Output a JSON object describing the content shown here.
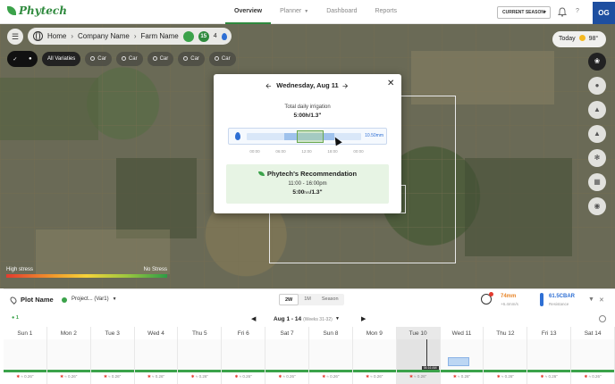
{
  "app": {
    "logo": "Phytech",
    "avatar": "OG"
  },
  "nav": {
    "items": [
      {
        "label": "Overview",
        "active": true,
        "dropdown": false
      },
      {
        "label": "Planner",
        "active": false,
        "dropdown": true
      },
      {
        "label": "Dashboard",
        "active": false,
        "dropdown": false
      },
      {
        "label": "Reports",
        "active": false,
        "dropdown": false
      }
    ],
    "season": "CURRENT SEASON",
    "help": "?"
  },
  "breadcrumb": {
    "home": "Home",
    "company": "Company Name",
    "farm": "Farm Name",
    "status_icons": [
      {
        "text": "",
        "color": "#3ba24a"
      },
      {
        "text": "15",
        "color": "#2f8a3e"
      },
      {
        "text": "4",
        "color": "#ffffff"
      }
    ]
  },
  "weather": {
    "label": "Today",
    "temp": "98°"
  },
  "varieties": {
    "all": "All Variaties",
    "items": [
      "Car",
      "Car",
      "Car",
      "Car",
      "Car"
    ]
  },
  "stress_legend": {
    "low_label": "High stress",
    "high_label": "No Stress"
  },
  "irrigation_modal": {
    "date": "Wednesday, Aug 11",
    "total_label": "Total daily irrigation",
    "total_value": "5:00h/1.3\"",
    "slider_value": "10.50mm",
    "ticks": [
      "00:00",
      "06:00",
      "12:00",
      "18:00",
      "00:00"
    ],
    "recommendation": {
      "title": "Phytech's Recommendation",
      "time": "11:00 - 16:00pm",
      "amount_hours": "5:00",
      "amount_unit": "hrs",
      "amount_inches": "/1.3\""
    }
  },
  "plot_panel": {
    "plot_label": "Plot Name",
    "project": "Project... (Var1)",
    "views": [
      {
        "label": "2W",
        "active": true
      },
      {
        "label": "1M",
        "active": false
      },
      {
        "label": "Season",
        "active": false
      }
    ],
    "kpi_rain": {
      "value": "74mm",
      "sub": "+6.4mm/s"
    },
    "kpi_soil": {
      "value": "61.5CBAR",
      "sub": "Resistance"
    },
    "range": "Aug 1 - 14",
    "range_weeks": "(Weeks 31-32)",
    "marker": "1",
    "days": [
      {
        "label": "Sun 1",
        "today": false,
        "irr": false,
        "foot": "0.26\""
      },
      {
        "label": "Mon 2",
        "today": false,
        "irr": false,
        "foot": "0.26\""
      },
      {
        "label": "Tue 3",
        "today": false,
        "irr": false,
        "foot": "0.26\""
      },
      {
        "label": "Wed 4",
        "today": false,
        "irr": false,
        "foot": "0.26\""
      },
      {
        "label": "Thu 5",
        "today": false,
        "irr": false,
        "foot": "0.26\""
      },
      {
        "label": "Fri 6",
        "today": false,
        "irr": false,
        "foot": "0.26\""
      },
      {
        "label": "Sat 7",
        "today": false,
        "irr": false,
        "foot": "0.26\""
      },
      {
        "label": "Sun 8",
        "today": false,
        "irr": false,
        "foot": "0.26\""
      },
      {
        "label": "Mon 9",
        "today": false,
        "irr": false,
        "foot": "0.26\""
      },
      {
        "label": "Tue 10",
        "today": true,
        "irr": false,
        "foot": "0.26\"",
        "now_tag": "06:16 AM"
      },
      {
        "label": "Wed 11",
        "today": false,
        "irr": true,
        "foot": "0.26\""
      },
      {
        "label": "Thu 12",
        "today": false,
        "irr": false,
        "foot": "0.26\""
      },
      {
        "label": "Fri 13",
        "today": false,
        "irr": false,
        "foot": "0.26\""
      },
      {
        "label": "Sat 14",
        "today": false,
        "irr": false,
        "foot": "0.26\""
      }
    ]
  }
}
